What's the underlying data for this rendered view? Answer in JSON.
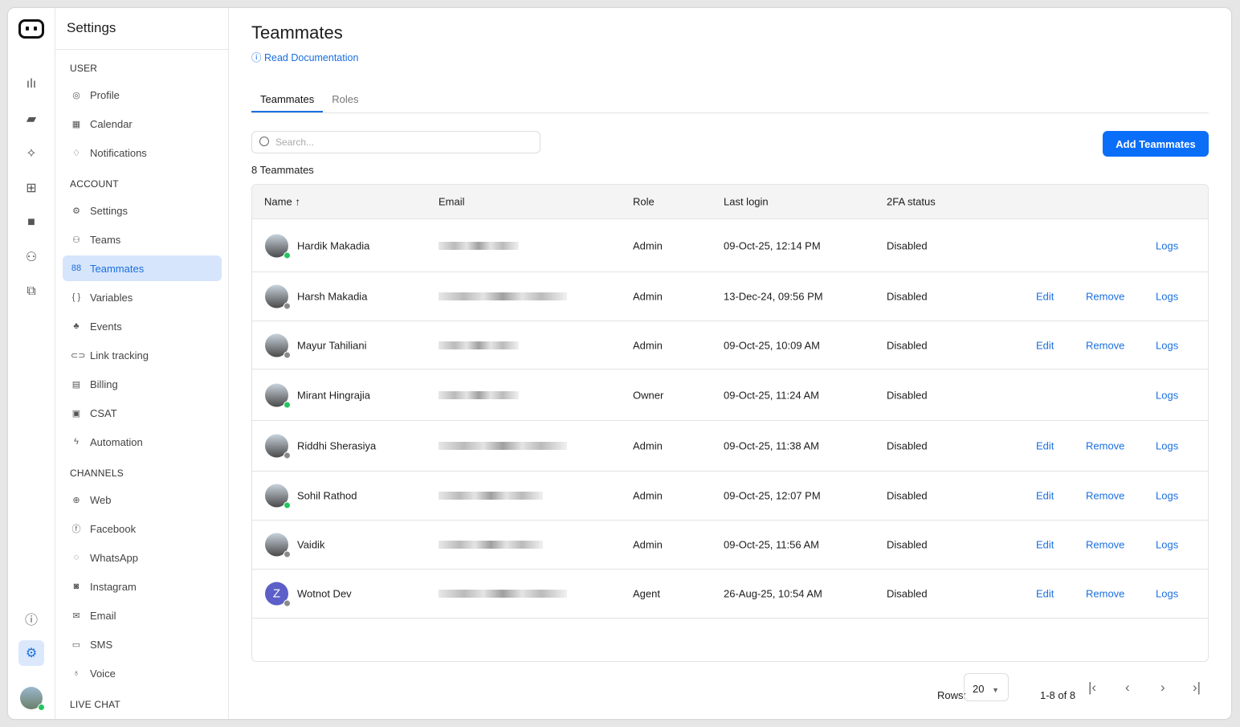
{
  "panel": {
    "title": "Settings",
    "sections": [
      {
        "label": "USER",
        "items": [
          {
            "label": "Profile",
            "icon": "user-circle-icon"
          },
          {
            "label": "Calendar",
            "icon": "calendar-icon"
          },
          {
            "label": "Notifications",
            "icon": "bell-icon"
          }
        ]
      },
      {
        "label": "ACCOUNT",
        "items": [
          {
            "label": "Settings",
            "icon": "gear-icon"
          },
          {
            "label": "Teams",
            "icon": "users-icon"
          },
          {
            "label": "Teammates",
            "icon": "teammates-icon",
            "active": true
          },
          {
            "label": "Variables",
            "icon": "braces-icon"
          },
          {
            "label": "Events",
            "icon": "events-icon"
          },
          {
            "label": "Link tracking",
            "icon": "link-icon"
          },
          {
            "label": "Billing",
            "icon": "billing-icon"
          },
          {
            "label": "CSAT",
            "icon": "csat-icon"
          },
          {
            "label": "Automation",
            "icon": "bolt-icon"
          }
        ]
      },
      {
        "label": "CHANNELS",
        "items": [
          {
            "label": "Web",
            "icon": "globe-icon"
          },
          {
            "label": "Facebook",
            "icon": "facebook-icon"
          },
          {
            "label": "WhatsApp",
            "icon": "whatsapp-icon"
          },
          {
            "label": "Instagram",
            "icon": "instagram-icon"
          },
          {
            "label": "Email",
            "icon": "mail-icon"
          },
          {
            "label": "SMS",
            "icon": "message-icon"
          },
          {
            "label": "Voice",
            "icon": "mic-icon"
          }
        ]
      },
      {
        "label": "LIVE CHAT",
        "items": []
      }
    ]
  },
  "main": {
    "title": "Teammates",
    "doc_link": "Read Documentation",
    "tabs": [
      "Teammates",
      "Roles"
    ],
    "search_placeholder": "Search...",
    "add_button": "Add Teammates",
    "count": "8 Teammates",
    "columns": [
      "Name",
      "Email",
      "Role",
      "Last login",
      "2FA status"
    ],
    "rows": [
      {
        "name": "Hardik Makadia",
        "role": "Admin",
        "login": "09-Oct-25, 12:14 PM",
        "twofa": "Disabled",
        "status": "online",
        "edit": false
      },
      {
        "name": "Harsh Makadia",
        "role": "Admin",
        "login": "13-Dec-24, 09:56 PM",
        "twofa": "Disabled",
        "status": "offline",
        "edit": true
      },
      {
        "name": "Mayur Tahiliani",
        "role": "Admin",
        "login": "09-Oct-25, 10:09 AM",
        "twofa": "Disabled",
        "status": "offline",
        "edit": true
      },
      {
        "name": "Mirant Hingrajia",
        "role": "Owner",
        "login": "09-Oct-25, 11:24 AM",
        "twofa": "Disabled",
        "status": "online",
        "edit": false
      },
      {
        "name": "Riddhi Sherasiya",
        "role": "Admin",
        "login": "09-Oct-25, 11:38 AM",
        "twofa": "Disabled",
        "status": "offline",
        "edit": true
      },
      {
        "name": "Sohil Rathod",
        "role": "Admin",
        "login": "09-Oct-25, 12:07 PM",
        "twofa": "Disabled",
        "status": "online",
        "edit": true
      },
      {
        "name": "Vaidik",
        "role": "Admin",
        "login": "09-Oct-25, 11:56 AM",
        "twofa": "Disabled",
        "status": "offline",
        "edit": true
      },
      {
        "name": "Wotnot Dev",
        "initial": "Z",
        "role": "Agent",
        "login": "26-Aug-25, 10:54 AM",
        "twofa": "Disabled",
        "status": "offline",
        "edit": true
      }
    ],
    "actions": {
      "edit": "Edit",
      "remove": "Remove",
      "logs": "Logs"
    },
    "pagination": {
      "rows_label": "Rows:",
      "rows_value": "20",
      "range": "1-8 of 8"
    }
  },
  "colors": {
    "accent": "#0b6ef9",
    "online": "#22c55e",
    "offline": "#8a8a8a"
  }
}
